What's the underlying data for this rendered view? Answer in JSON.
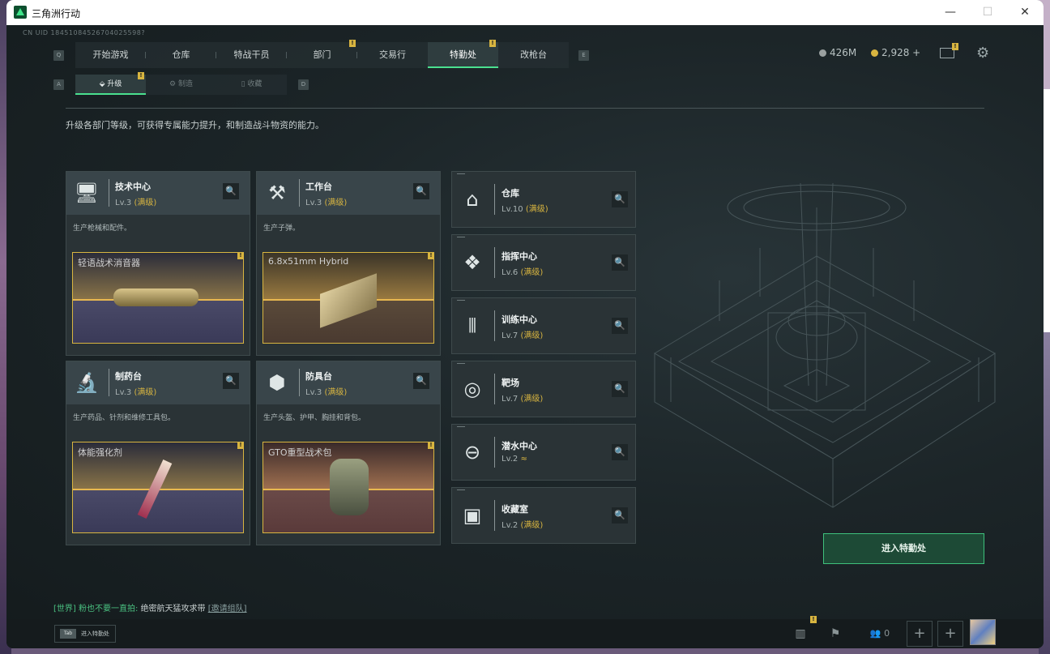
{
  "window": {
    "title": "三角洲行动",
    "minimize": "—",
    "maximize": "☐",
    "close": "✕"
  },
  "uid": "CN UID 18451084526704025598?",
  "nav": {
    "left_key": "Q",
    "right_key": "E",
    "tabs": [
      {
        "label": "开始游戏"
      },
      {
        "label": "仓库"
      },
      {
        "label": "特战干员"
      },
      {
        "label": "部门"
      },
      {
        "label": "交易行"
      },
      {
        "label": "特勤处"
      },
      {
        "label": "改枪台"
      }
    ],
    "active": "特勤处",
    "badge": "!"
  },
  "currency": {
    "primary": "426M",
    "secondary": "2,928 +"
  },
  "subnav": {
    "left_key": "A",
    "right_key": "D",
    "tabs": [
      {
        "label": "升级"
      },
      {
        "label": "制造"
      },
      {
        "label": "收藏"
      }
    ]
  },
  "description": "升级各部门等级，可获得专属能力提升，和制造战斗物资的能力。",
  "departments": [
    {
      "name": "技术中心",
      "level": "Lv.3",
      "status": "(满级)",
      "desc": "生产枪械和配件。",
      "item": "轻语战术消音器",
      "icon": "monitor-icon"
    },
    {
      "name": "工作台",
      "level": "Lv.3",
      "status": "(满级)",
      "desc": "生产子弹。",
      "item": "6.8x51mm Hybrid",
      "icon": "tools-icon"
    },
    {
      "name": "制药台",
      "level": "Lv.3",
      "status": "(满级)",
      "desc": "生产药品、针剂和维修工具包。",
      "item": "体能强化剂",
      "icon": "microscope-icon"
    },
    {
      "name": "防具台",
      "level": "Lv.3",
      "status": "(满级)",
      "desc": "生产头盔、护甲、胸挂和背包。",
      "item": "GTO重型战术包",
      "icon": "boxes-icon"
    }
  ],
  "facilities": [
    {
      "name": "仓库",
      "level": "Lv.10",
      "status": "(满级)",
      "icon": "warehouse-icon"
    },
    {
      "name": "指挥中心",
      "level": "Lv.6",
      "status": "(满级)",
      "icon": "command-icon"
    },
    {
      "name": "训练中心",
      "level": "Lv.7",
      "status": "(满级)",
      "icon": "dumbbell-icon"
    },
    {
      "name": "靶场",
      "level": "Lv.7",
      "status": "(满级)",
      "icon": "target-icon"
    },
    {
      "name": "潜水中心",
      "level": "Lv.2",
      "status": "≈",
      "icon": "diving-icon"
    },
    {
      "name": "收藏室",
      "level": "Lv.2",
      "status": "(满级)",
      "icon": "collection-icon"
    }
  ],
  "enter_button": "进入特勤处",
  "chat": {
    "channel": "[世界]",
    "sender": "粉也不要一直拍:",
    "message": "绝密航天猛攻求带",
    "link": "[邀请组队]"
  },
  "tab_hint": {
    "key": "Tab",
    "label": "进入特勤处"
  },
  "friends_count": "0",
  "colors": {
    "accent": "#4ae08f",
    "gold": "#d8b540",
    "bg": "#1a2326"
  }
}
